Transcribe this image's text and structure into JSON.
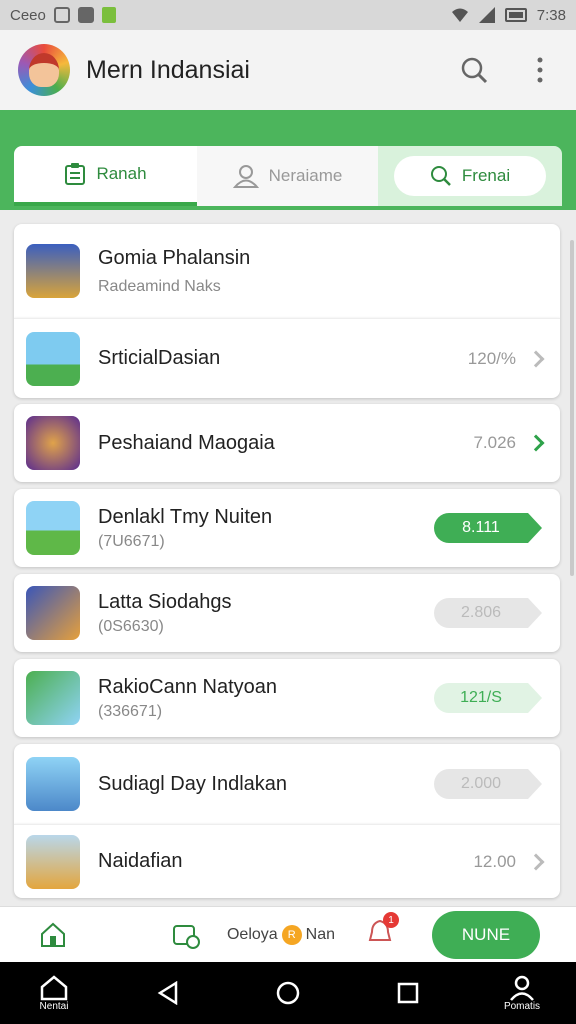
{
  "status_bar": {
    "left_text": "Ceeo",
    "time": "7:38"
  },
  "app_bar": {
    "title": "Mern Indansiai"
  },
  "tabs": {
    "home": "Ranah",
    "profile": "Neraiame",
    "search": "Frenai"
  },
  "items": [
    {
      "name": "Gomia Phalansin",
      "subtitle": "Radeamind Naks",
      "value": "",
      "badge": "",
      "badge_style": ""
    },
    {
      "name": "SrticialDasian",
      "subtitle": "",
      "value": "120/%",
      "badge": "",
      "badge_style": ""
    },
    {
      "name": "Peshaiand Maogaia",
      "subtitle": "",
      "value": "7.026",
      "badge": "",
      "badge_style": ""
    },
    {
      "name": "Denlakl Tmy Nuiten",
      "subtitle": "(7U6671)",
      "value": "",
      "badge": "8.111",
      "badge_style": "green"
    },
    {
      "name": "Latta Siodahgs",
      "subtitle": "(0S6630)",
      "value": "",
      "badge": "2.806",
      "badge_style": "grey"
    },
    {
      "name": "RakioCann Natyoan",
      "subtitle": "(336671)",
      "value": "",
      "badge": "121/S",
      "badge_style": "light"
    },
    {
      "name": "Sudiagl Day Indlakan",
      "subtitle": "",
      "value": "",
      "badge": "2.000",
      "badge_style": "grey"
    },
    {
      "name": "Naidafian",
      "subtitle": "",
      "value": "12.00",
      "badge": "",
      "badge_style": ""
    }
  ],
  "bottom_nav": {
    "downloads_label": "Oeloya",
    "coin_label": "R",
    "downloads_suffix": "Nan",
    "notification_count": "1",
    "cta_label": "NUNE"
  },
  "system_nav": {
    "home_label": "Nentai",
    "profile_label": "Pomatis"
  },
  "colors": {
    "accent_green": "#3fae55",
    "header_green": "#4cb55c"
  }
}
